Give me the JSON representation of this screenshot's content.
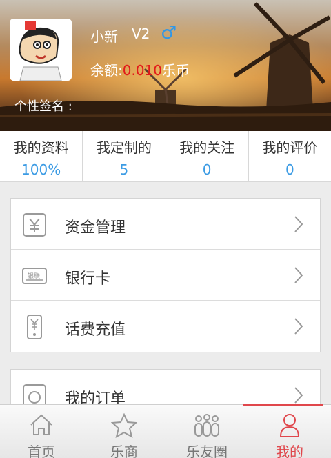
{
  "profile": {
    "name": "小新",
    "level": "V2",
    "gender_icon": "male-icon",
    "balance_label": "余额:",
    "balance_amount": "0.010",
    "balance_unit": "乐币",
    "signature_label": "个性签名 :"
  },
  "stats": [
    {
      "label": "我的资料",
      "value": "100%"
    },
    {
      "label": "我定制的",
      "value": "5"
    },
    {
      "label": "我的关注",
      "value": "0"
    },
    {
      "label": "我的评价",
      "value": "0"
    }
  ],
  "menu_group_1": [
    {
      "label": "资金管理",
      "icon": "yuan-icon"
    },
    {
      "label": "银行卡",
      "icon": "bank-card-icon"
    },
    {
      "label": "话费充值",
      "icon": "phone-recharge-icon"
    }
  ],
  "menu_group_2": [
    {
      "label": "我的订单",
      "icon": "order-icon"
    }
  ],
  "bank_icon_text": "银联",
  "tabs": [
    {
      "label": "首页",
      "icon": "home-icon"
    },
    {
      "label": "乐商",
      "icon": "star-icon"
    },
    {
      "label": "乐友圈",
      "icon": "friends-icon"
    },
    {
      "label": "我的",
      "icon": "user-icon"
    }
  ],
  "colors": {
    "accent": "#3b9be4",
    "balance": "#e21a1a",
    "active_tab": "#e0474c"
  }
}
